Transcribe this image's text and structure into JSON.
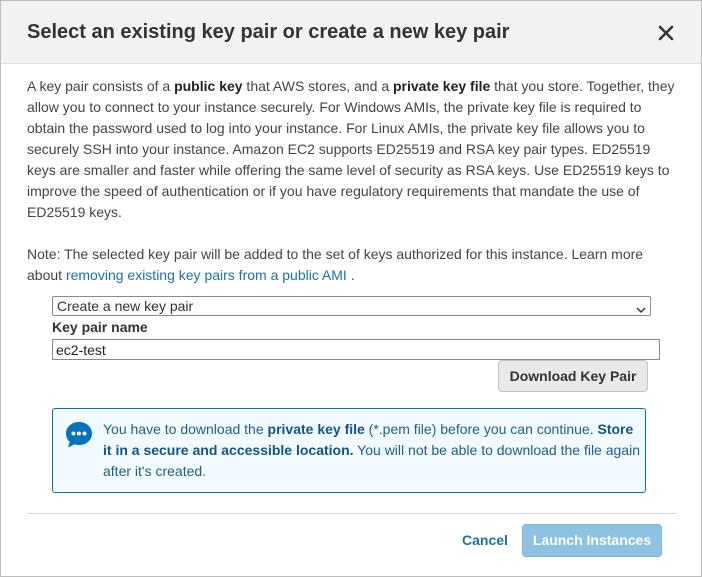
{
  "dialog": {
    "title": "Select an existing key pair or create a new key pair"
  },
  "body": {
    "p1": "A key pair consists of a ",
    "public_key": "public key",
    "p2": " that AWS stores, and a ",
    "private_key_file": "private key file",
    "p3": " that you store. Together, they allow you to connect to your instance securely. For Windows AMIs, the private key file is required to obtain the password used to log into your instance. For Linux AMIs, the private key file allows you to securely SSH into your instance. Amazon EC2 supports ED25519 and RSA key pair types. ED25519 keys are smaller and faster while offering the same level of security as RSA keys. Use ED25519 keys to improve the speed of authentication or if you have regulatory requirements that mandate the use of ED25519 keys."
  },
  "note": {
    "text": "Note: The selected key pair will be added to the set of keys authorized for this instance. Learn more about ",
    "link": "removing existing key pairs from a public AMI",
    "end": " ."
  },
  "form": {
    "key_pair_mode": "Create a new key pair",
    "key_pair_name_label": "Key pair name",
    "key_pair_name_value": "ec2-test",
    "download_label": "Download Key Pair"
  },
  "info": {
    "t1": "You have to download the ",
    "b1": "private key file",
    "t2": " (*.pem file) before you can continue. ",
    "b2": "Store it in a secure and accessible location.",
    "t3": " You will not be able to download the file again after it's created."
  },
  "footer": {
    "cancel_label": "Cancel",
    "launch_label": "Launch Instances"
  },
  "colors": {
    "link": "#1a73a8",
    "info_border": "#0073bb",
    "info_bg": "#f1faff",
    "launch_btn_bg": "#8ec2e3"
  }
}
